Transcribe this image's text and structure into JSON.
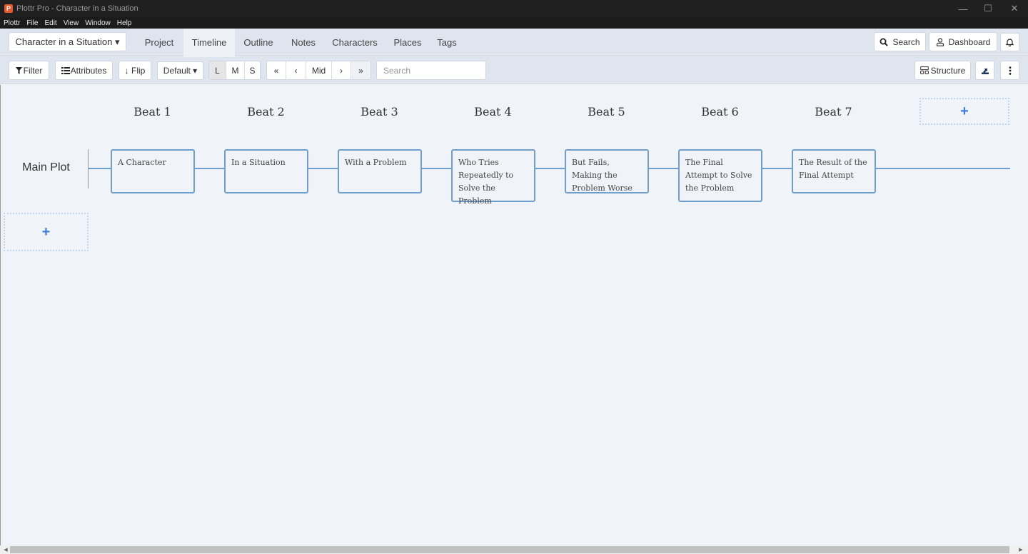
{
  "window": {
    "title": "Plottr Pro - Character in a Situation",
    "logo_glyph": "P",
    "minimize_glyph": "—",
    "maximize_glyph": "☐",
    "close_glyph": "✕"
  },
  "menubar": {
    "items": [
      "Plottr",
      "File",
      "Edit",
      "View",
      "Window",
      "Help"
    ]
  },
  "navbar": {
    "project_label": "Character in a Situation ▾",
    "tabs": [
      {
        "label": "Project",
        "active": false
      },
      {
        "label": "Timeline",
        "active": true
      },
      {
        "label": "Outline",
        "active": false
      },
      {
        "label": "Notes",
        "active": false
      },
      {
        "label": "Characters",
        "active": false
      },
      {
        "label": "Places",
        "active": false
      },
      {
        "label": "Tags",
        "active": false
      }
    ],
    "search_label": "Search",
    "dashboard_label": "Dashboard"
  },
  "toolbar": {
    "filter_label": "Filter",
    "attributes_label": "Attributes",
    "flip_label": "↓ Flip",
    "default_label": "Default ▾",
    "sizes": [
      "L",
      "M",
      "S"
    ],
    "selected_size": "L",
    "nav": [
      "«",
      "‹",
      "Mid",
      "›",
      "»"
    ],
    "search_placeholder": "Search",
    "structure_label": "Structure"
  },
  "timeline": {
    "beats": [
      "Beat 1",
      "Beat 2",
      "Beat 3",
      "Beat 4",
      "Beat 5",
      "Beat 6",
      "Beat 7"
    ],
    "add_glyph": "+",
    "plotlines": [
      {
        "name": "Main Plot",
        "color": "#6f9fcf",
        "cards": [
          "A Character",
          "In a Situation",
          "With a Problem",
          "Who Tries Repeatedly to Solve the Problem",
          "But Fails, Making the Problem Worse",
          "The Final Attempt to Solve the Problem",
          "The Result of the Final Attempt"
        ]
      }
    ]
  }
}
